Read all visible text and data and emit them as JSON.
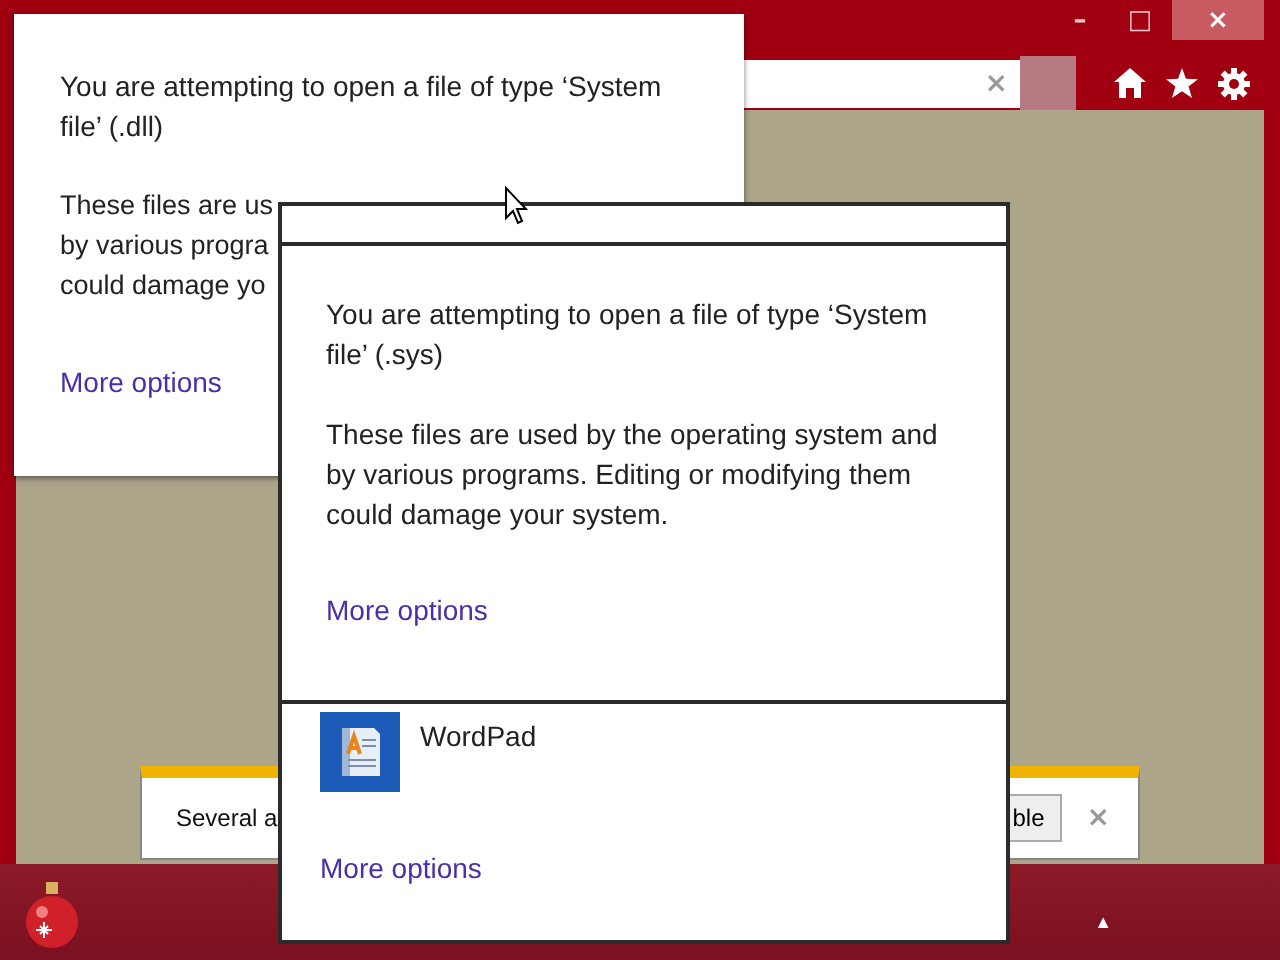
{
  "browser": {
    "caption_buttons": [
      "–",
      "□",
      "×"
    ],
    "address_clear": "×"
  },
  "notification": {
    "text": "Several a",
    "button": "ble",
    "close": "×"
  },
  "back_dialog": {
    "message": "You are attempting to open a file of type ‘System file’ (.dll)",
    "detail_lines": [
      "These files are us",
      "by various progra",
      "could damage yo"
    ],
    "link": "More options"
  },
  "front_dialog": {
    "message": "You are attempting to open a file of type ‘System file’ (.sys)",
    "detail": "These files are used by the operating system and by various programs. Editing or modifying them could damage your system.",
    "link": "More options",
    "apps": [
      {
        "name": "WordPad"
      }
    ],
    "apps_link": "More options"
  },
  "taskbar": {
    "tray_arrow": "▲"
  }
}
